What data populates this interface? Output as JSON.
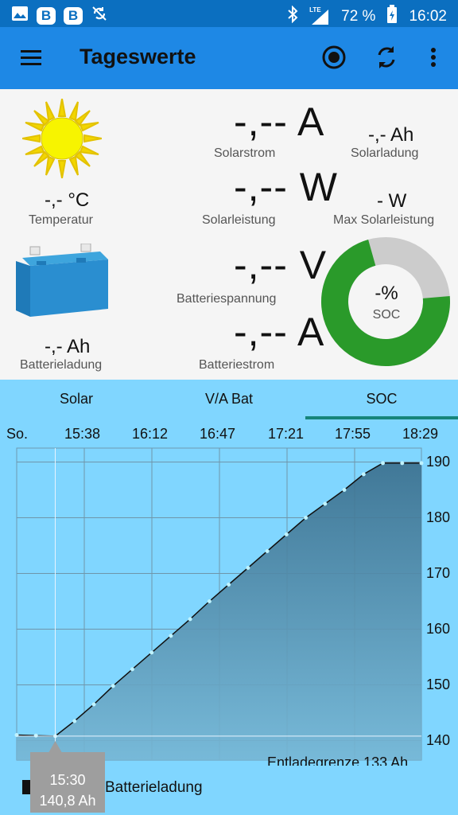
{
  "status": {
    "battery_pct": "72 %",
    "time": "16:02",
    "network": "LTE"
  },
  "appbar": {
    "title": "Tageswerte"
  },
  "panel": {
    "solarstrom": {
      "value": "-,-- A",
      "label": "Solarstrom"
    },
    "solarladung": {
      "value": "-,- Ah",
      "label": "Solarladung"
    },
    "temperatur": {
      "value": "-,- °C",
      "label": "Temperatur"
    },
    "solarleistung": {
      "value": "-,-- W",
      "label": "Solarleistung"
    },
    "max_solarleistung": {
      "value": "- W",
      "label": "Max Solarleistung"
    },
    "batteriespannung": {
      "value": "-,-- V",
      "label": "Batteriespannung"
    },
    "batterieladung": {
      "value": "-,- Ah",
      "label": "Batterieladung"
    },
    "batteriestrom": {
      "value": "-,-- A",
      "label": "Batteriestrom"
    },
    "soc": {
      "value": "-%",
      "label": "SOC",
      "fraction": 0.72
    }
  },
  "tabs": [
    {
      "label": "Solar",
      "selected": false
    },
    {
      "label": "V/A Bat",
      "selected": false
    },
    {
      "label": "SOC",
      "selected": true
    }
  ],
  "colors": {
    "statusbar": "#0b6fc0",
    "appbar": "#1e88e5",
    "chart_bg": "#80d6ff",
    "accent": "#16857a",
    "soc_fill": "#2a9a2a",
    "soc_rest": "#cccccc"
  },
  "chart_data": {
    "type": "area",
    "x_labels": [
      "So.",
      "15:38",
      "16:12",
      "16:47",
      "17:21",
      "17:55",
      "18:29"
    ],
    "y_ticks": [
      140,
      150,
      160,
      170,
      180,
      190
    ],
    "ylim": [
      136.5,
      192.5
    ],
    "x": [
      "15:10",
      "15:20",
      "15:30",
      "15:40",
      "15:50",
      "16:00",
      "16:10",
      "16:20",
      "16:30",
      "16:40",
      "16:50",
      "17:00",
      "17:10",
      "17:20",
      "17:30",
      "17:40",
      "17:50",
      "18:00",
      "18:10",
      "18:20",
      "18:30",
      "18:40"
    ],
    "values": [
      141.0,
      140.9,
      140.8,
      143.5,
      146.5,
      149.8,
      152.8,
      155.8,
      158.8,
      161.8,
      165.0,
      168.0,
      171.0,
      174.0,
      177.0,
      180.0,
      182.5,
      185.0,
      187.8,
      189.8,
      189.8,
      189.8
    ],
    "series": [
      {
        "name": "Batterieladung"
      }
    ],
    "limit_line": {
      "label": "Entladegrenze 133 Ah",
      "value": 133
    },
    "tooltip": {
      "time": "15:30",
      "value": "140,8 Ah"
    },
    "legend": "Batterieladung"
  }
}
